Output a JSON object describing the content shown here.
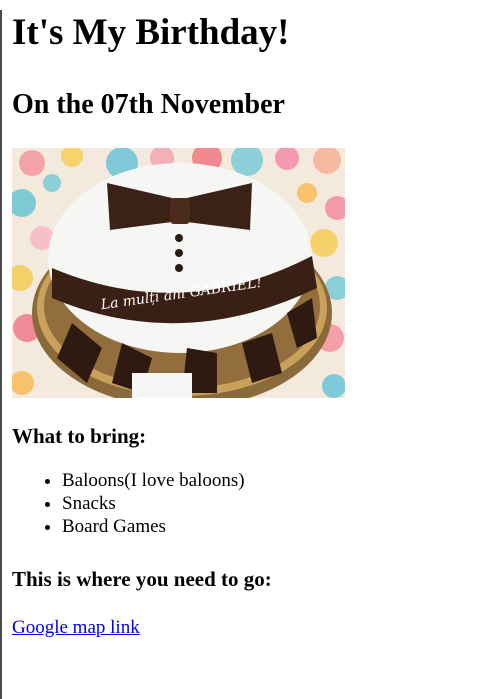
{
  "heading": "It's My Birthday!",
  "date_heading": "On the 07th November",
  "cake_image": {
    "banner_text": "La mulți ani GABRIEL!"
  },
  "bring_heading": "What to bring:",
  "bring_items": [
    "Baloons(I love baloons)",
    "Snacks",
    "Board Games"
  ],
  "where_heading": "This is where you need to go:",
  "map_link": "Google map link"
}
